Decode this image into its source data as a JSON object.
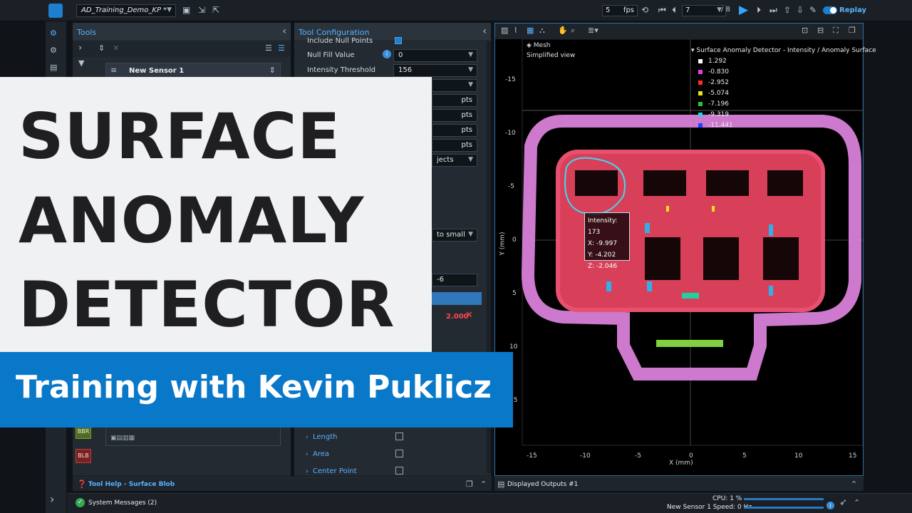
{
  "topbar": {
    "job_name": "AD_Training_Demo_KP *",
    "fps_value": "5",
    "fps_unit": "fps",
    "frame_value": "7",
    "frame_total": "/ 8",
    "replay_label": "Replay"
  },
  "tools_panel": {
    "title": "Tools",
    "sensor_name": "New Sensor 1",
    "tool_badges": [
      "BBR",
      "BLB"
    ]
  },
  "tool_config": {
    "title": "Tool Configuration",
    "rows": [
      {
        "label": "Include Null Points"
      },
      {
        "label": "Null Fill Value",
        "value": "0"
      },
      {
        "label": "Intensity Threshold",
        "value": "156"
      }
    ],
    "unit_pts": "pts",
    "dropdown_objects": "jects",
    "dropdown_small": "to small",
    "small_value": "-6",
    "red_value": "2.000",
    "outputs": [
      {
        "label": "Length"
      },
      {
        "label": "Area"
      },
      {
        "label": "Center Point"
      }
    ]
  },
  "viewer": {
    "mesh_label": "Mesh",
    "view_label": "Simplified view",
    "legend_title": "Surface Anomaly Detector - Intensity / Anomaly Surface",
    "legend": [
      {
        "value": "1.292",
        "color": "#ffffff"
      },
      {
        "value": "-0.830",
        "color": "#e040e0"
      },
      {
        "value": "-2.952",
        "color": "#ff2a2a"
      },
      {
        "value": "-5.074",
        "color": "#f0e020"
      },
      {
        "value": "-7.196",
        "color": "#30c030"
      },
      {
        "value": "-9.319",
        "color": "#30d0e0"
      },
      {
        "value": "-11.441",
        "color": "#2040ff"
      }
    ],
    "tooltip": {
      "intensity": "Intensity: 173",
      "x": "X: -9.997",
      "y": "Y: -4.202",
      "z": "Z: -2.046"
    },
    "x_ticks": [
      "-15",
      "-10",
      "-5",
      "0",
      "5",
      "10",
      "15"
    ],
    "y_ticks": [
      "-15",
      "-10",
      "-5",
      "0",
      "5",
      "10",
      "15"
    ],
    "x_axis_label": "X (mm)",
    "y_axis_label": "Y (mm)",
    "displayed_outputs": "Displayed Outputs",
    "displayed_outputs_id": "#1"
  },
  "bottom": {
    "tool_help": "Tool Help - Surface Blob",
    "system_messages": "System Messages (2)",
    "cpu": "CPU: 1 %",
    "speed": "New Sensor 1 Speed:  0 Hz"
  },
  "overlay": {
    "title_lines": [
      "SURFACE",
      "ANOMALY",
      "DETECTOR"
    ],
    "subtitle": "Training with Kevin Puklicz"
  },
  "colors": {
    "accent": "#58b2ff",
    "banner": "#0a78c8",
    "play": "#2fa7ff"
  }
}
